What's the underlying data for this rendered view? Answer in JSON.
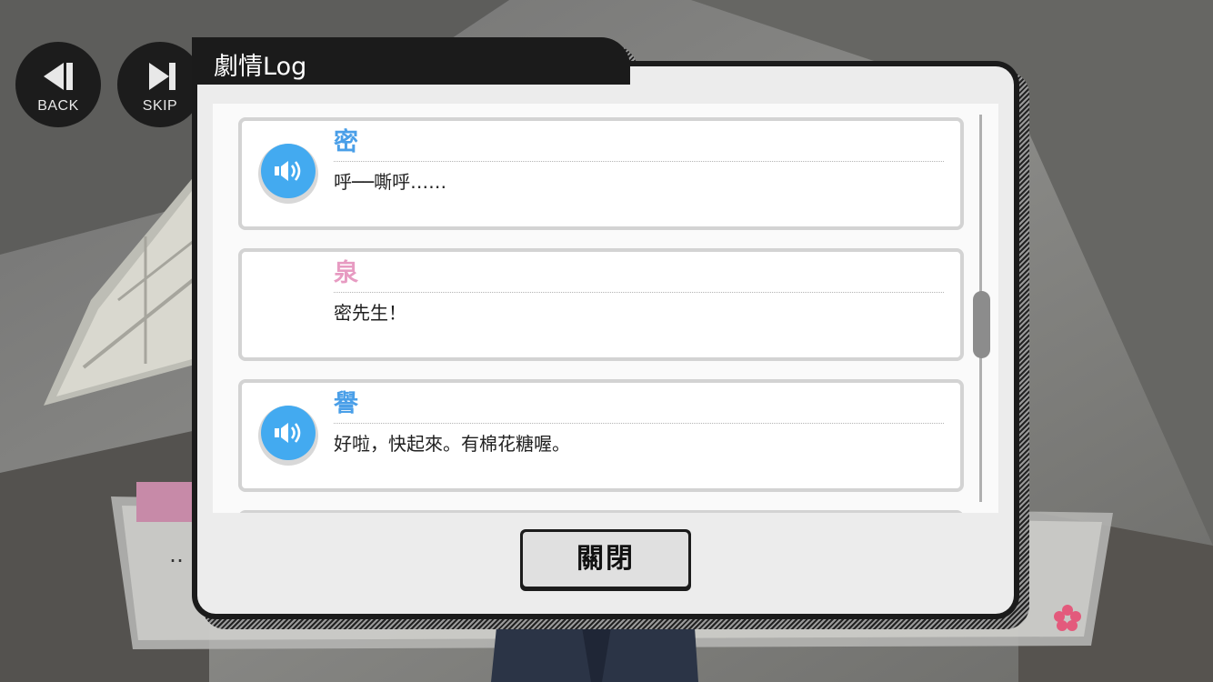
{
  "controls": {
    "back_label": "BACK",
    "skip_label": "SKIP"
  },
  "log": {
    "title": "劇情Log",
    "close_label": "關閉",
    "entries": [
      {
        "speaker": "密",
        "speaker_color": "#4a9fe8",
        "text": "呼──嘶呼……",
        "has_voice": true
      },
      {
        "speaker": "泉",
        "speaker_color": "#e79bc2",
        "text": "密先生！",
        "has_voice": false
      },
      {
        "speaker": "譽",
        "speaker_color": "#4a9fe8",
        "text": "好啦，快起來。有棉花糖喔。",
        "has_voice": true
      }
    ]
  },
  "background": {
    "dialogue_fragment": "‥"
  },
  "colors": {
    "voice_button": "#43aaf0",
    "window_frame": "#1b1b1b",
    "window_body": "#ececec"
  }
}
